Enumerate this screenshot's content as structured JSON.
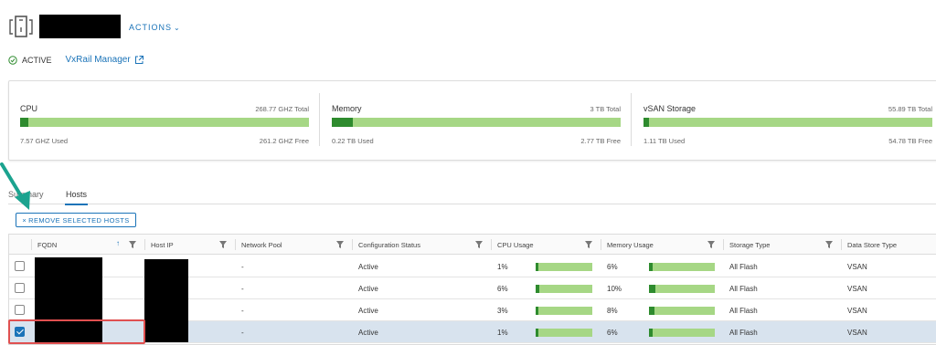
{
  "header": {
    "actions_label": "ACTIONS",
    "status_label": "ACTIVE",
    "vxrail_link": "VxRail Manager"
  },
  "resources": {
    "cpu": {
      "name": "CPU",
      "total": "268.77 GHZ Total",
      "used": "7.57 GHZ Used",
      "free": "261.2 GHZ Free",
      "used_fraction": 0.028
    },
    "memory": {
      "name": "Memory",
      "total": "3 TB Total",
      "used": "0.22 TB Used",
      "free": "2.77 TB Free",
      "used_fraction": 0.073
    },
    "vsan": {
      "name": "vSAN Storage",
      "total": "55.89 TB Total",
      "used": "1.11 TB Used",
      "free": "54.78 TB Free",
      "used_fraction": 0.02
    }
  },
  "tabs": {
    "summary": "Summary",
    "hosts": "Hosts",
    "active": "Hosts"
  },
  "remove_button": "REMOVE SELECTED HOSTS",
  "grid": {
    "columns": {
      "fqdn": "FQDN",
      "host_ip": "Host IP",
      "network_pool": "Network Pool",
      "config_status": "Configuration Status",
      "cpu_usage": "CPU Usage",
      "memory_usage": "Memory Usage",
      "storage_type": "Storage Type",
      "datastore_type": "Data Store Type"
    },
    "rows": [
      {
        "network_pool": "-",
        "config_status": "Active",
        "cpu_usage": "1%",
        "cpu_fraction": 0.01,
        "memory_usage": "6%",
        "mem_fraction": 0.06,
        "storage_type": "All Flash",
        "datastore_type": "VSAN",
        "selected": false
      },
      {
        "network_pool": "-",
        "config_status": "Active",
        "cpu_usage": "6%",
        "cpu_fraction": 0.06,
        "memory_usage": "10%",
        "mem_fraction": 0.1,
        "storage_type": "All Flash",
        "datastore_type": "VSAN",
        "selected": false
      },
      {
        "network_pool": "-",
        "config_status": "Active",
        "cpu_usage": "3%",
        "cpu_fraction": 0.03,
        "memory_usage": "8%",
        "mem_fraction": 0.08,
        "storage_type": "All Flash",
        "datastore_type": "VSAN",
        "selected": false
      },
      {
        "network_pool": "-",
        "config_status": "Active",
        "cpu_usage": "1%",
        "cpu_fraction": 0.01,
        "memory_usage": "6%",
        "mem_fraction": 0.06,
        "storage_type": "All Flash",
        "datastore_type": "VSAN",
        "selected": true
      }
    ]
  },
  "colors": {
    "accent": "#1a73b8",
    "bar_bg": "#a6d785",
    "bar_fill": "#2e8b2e",
    "selected_row": "#d8e3ee",
    "highlight": "#e05050",
    "arrow": "#1ba38f"
  }
}
